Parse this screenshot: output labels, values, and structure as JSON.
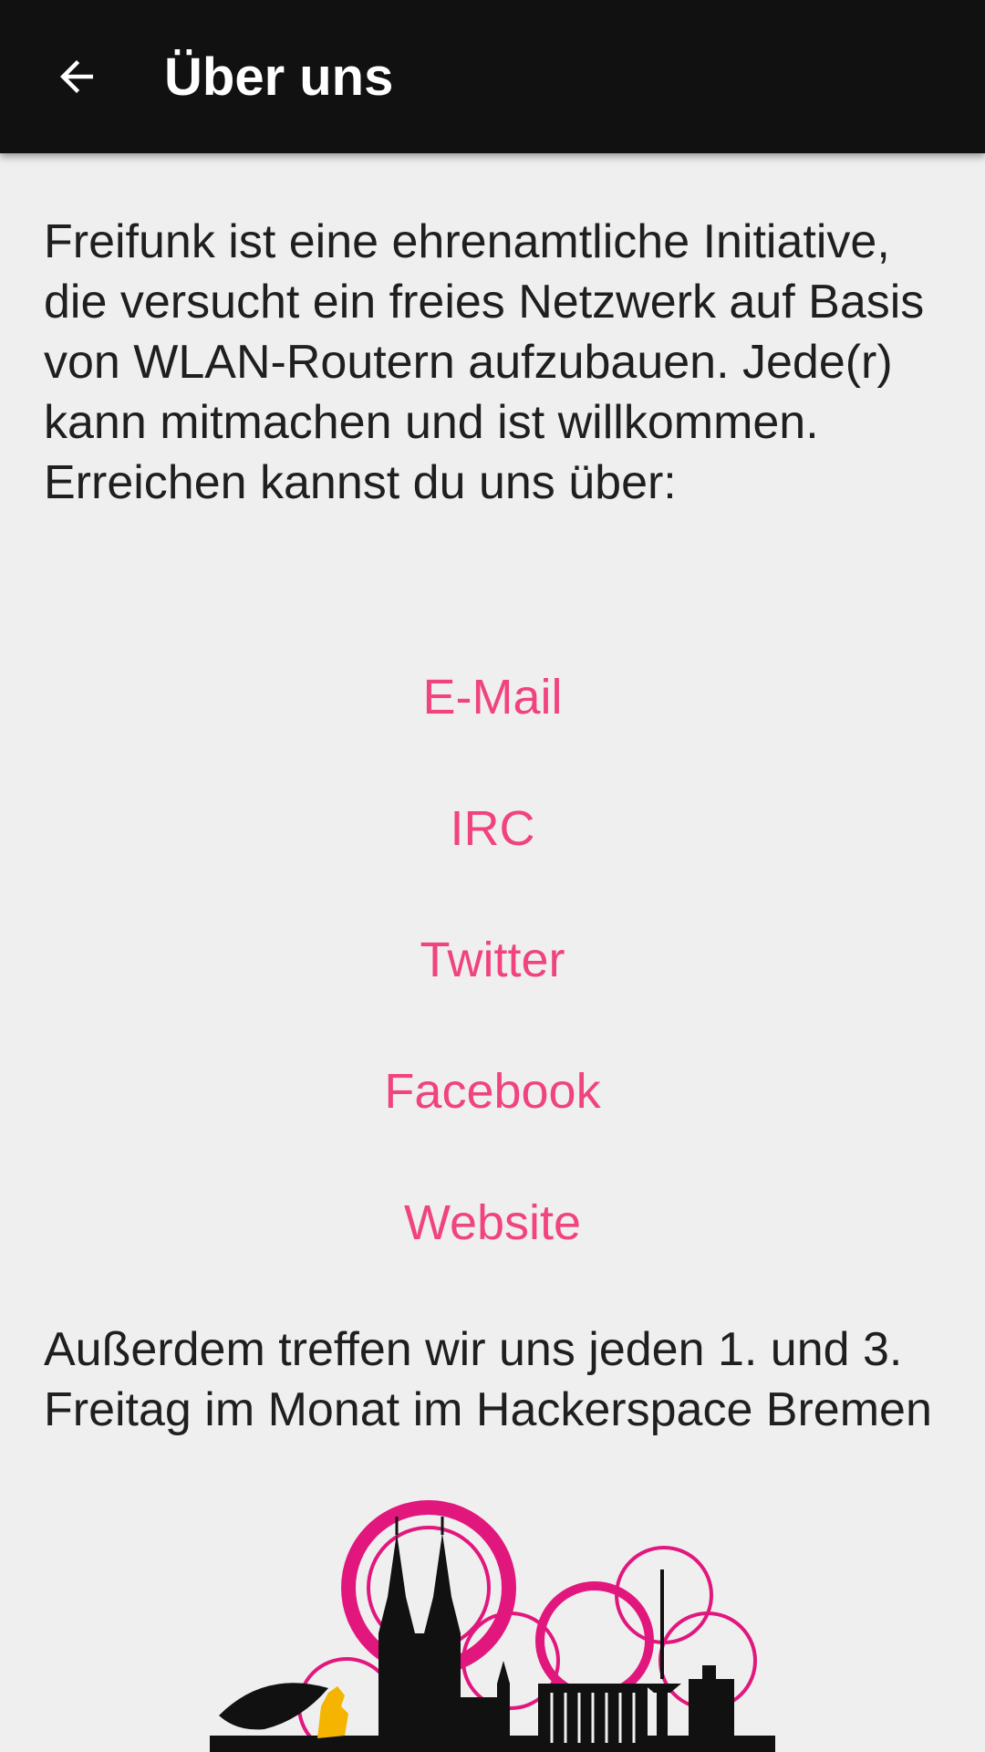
{
  "app_bar": {
    "title": "Über uns",
    "back_icon": "arrow-back-icon"
  },
  "content": {
    "intro": "Freifunk ist eine ehrenamtliche Initiative, die versucht ein freies Netzwerk auf Basis von WLAN-Routern aufzubauen. Jede(r) kann mitmachen und ist willkommen. Erreichen kannst du uns über:",
    "links": [
      {
        "label": "E-Mail"
      },
      {
        "label": "IRC"
      },
      {
        "label": "Twitter"
      },
      {
        "label": "Facebook"
      },
      {
        "label": "Website"
      }
    ],
    "outro": "Außerdem treffen wir uns jeden 1. und 3. Freitag im Monat im Hackerspace Bremen"
  },
  "colors": {
    "app_bar": "#111111",
    "background": "#efefef",
    "link": "#f0437f",
    "logo_pink": "#e2177e",
    "logo_black": "#111111",
    "logo_yellow": "#f5b400"
  }
}
